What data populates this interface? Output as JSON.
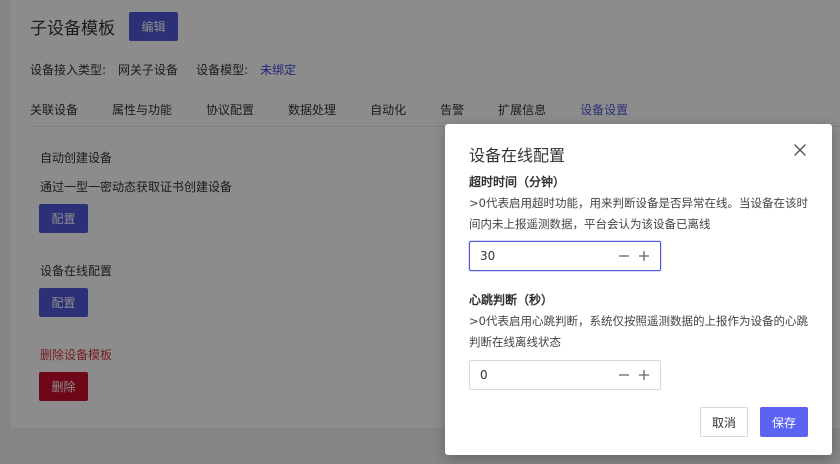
{
  "header": {
    "title": "子设备模板",
    "edit_label": "编辑"
  },
  "meta": {
    "access_type_label": "设备接入类型:",
    "access_type_value": "网关子设备",
    "model_label": "设备模型:",
    "model_value": "未绑定"
  },
  "tabs": [
    {
      "label": "关联设备"
    },
    {
      "label": "属性与功能"
    },
    {
      "label": "协议配置"
    },
    {
      "label": "数据处理"
    },
    {
      "label": "自动化"
    },
    {
      "label": "告警"
    },
    {
      "label": "扩展信息"
    },
    {
      "label": "设备设置",
      "active": true
    }
  ],
  "settings": {
    "auto_create": {
      "title": "自动创建设备",
      "desc": "通过一型一密动态获取证书创建设备",
      "button": "配置"
    },
    "online_config": {
      "title": "设备在线配置",
      "button": "配置"
    },
    "delete_template": {
      "title": "删除设备模板",
      "button": "删除"
    }
  },
  "modal": {
    "title": "设备在线配置",
    "timeout": {
      "label": "超时时间（分钟）",
      "help": ">0代表启用超时功能，用来判断设备是否异常在线。当设备在该时间内未上报遥测数据，平台会认为该设备已离线",
      "value": "30"
    },
    "heartbeat": {
      "label": "心跳判断（秒）",
      "help": ">0代表启用心跳判断，系统仅按照遥测数据的上报作为设备的心跳判断在线离线状态",
      "value": "0"
    },
    "cancel_label": "取消",
    "save_label": "保存"
  },
  "colors": {
    "accent": "#5159d9",
    "danger": "#c8102e",
    "save": "#5c63f2"
  }
}
